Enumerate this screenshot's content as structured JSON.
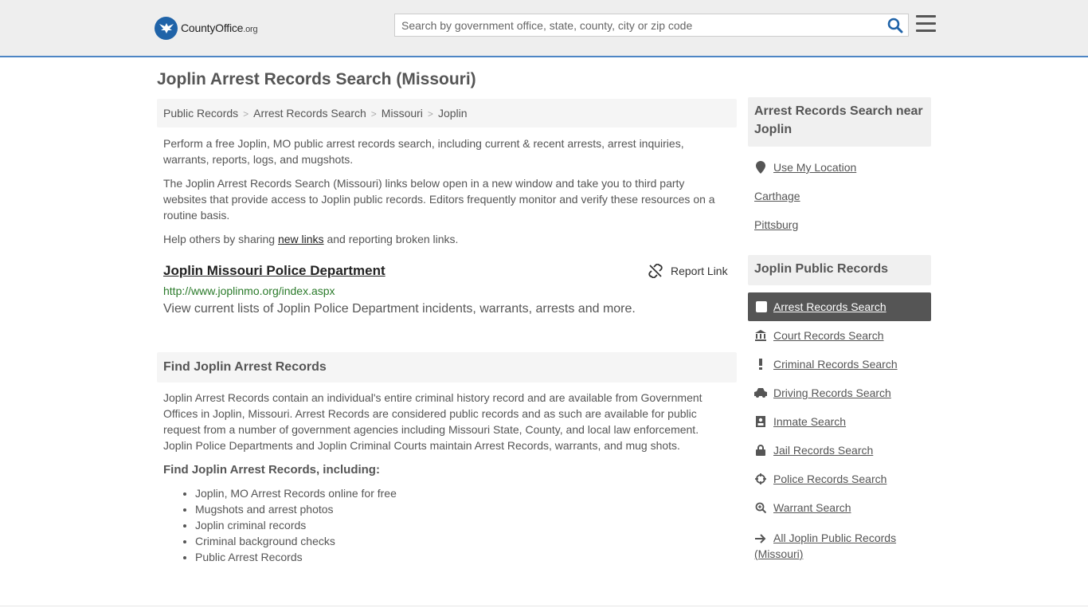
{
  "header": {
    "logo_name": "CountyOffice",
    "logo_tld": ".org",
    "search_placeholder": "Search by government office, state, county, city or zip code"
  },
  "page": {
    "title": "Joplin Arrest Records Search (Missouri)",
    "breadcrumb": [
      "Public Records",
      "Arrest Records Search",
      "Missouri",
      "Joplin"
    ],
    "intro_1": "Perform a free Joplin, MO public arrest records search, including current & recent arrests, arrest inquiries, warrants, reports, logs, and mugshots.",
    "intro_2": "The Joplin Arrest Records Search (Missouri) links below open in a new window and take you to third party websites that provide access to Joplin public records. Editors frequently monitor and verify these resources on a routine basis.",
    "help_before": "Help others by sharing ",
    "help_link": "new links",
    "help_after": " and reporting broken links."
  },
  "result": {
    "title": "Joplin Missouri Police Department",
    "report_label": "Report Link",
    "url": "http://www.joplinmo.org/index.aspx",
    "description": "View current lists of Joplin Police Department incidents, warrants, arrests and more."
  },
  "find": {
    "heading": "Find Joplin Arrest Records",
    "body": "Joplin Arrest Records contain an individual's entire criminal history record and are available from Government Offices in Joplin, Missouri. Arrest Records are considered public records and as such are available for public request from a number of government agencies including Missouri State, County, and local law enforcement. Joplin Police Departments and Joplin Criminal Courts maintain Arrest Records, warrants, and mug shots.",
    "subheading": "Find Joplin Arrest Records, including:",
    "bullets": [
      "Joplin, MO Arrest Records online for free",
      "Mugshots and arrest photos",
      "Joplin criminal records",
      "Criminal background checks",
      "Public Arrest Records"
    ]
  },
  "sidebar": {
    "near_heading": "Arrest Records Search near Joplin",
    "near_links": [
      "Use My Location",
      "Carthage",
      "Pittsburg"
    ],
    "records_heading": "Joplin Public Records",
    "active_link": "Arrest Records Search",
    "record_links": [
      "Court Records Search",
      "Criminal Records Search",
      "Driving Records Search",
      "Inmate Search",
      "Jail Records Search",
      "Police Records Search",
      "Warrant Search"
    ],
    "all_link": "All Joplin Public Records (Missouri)"
  }
}
